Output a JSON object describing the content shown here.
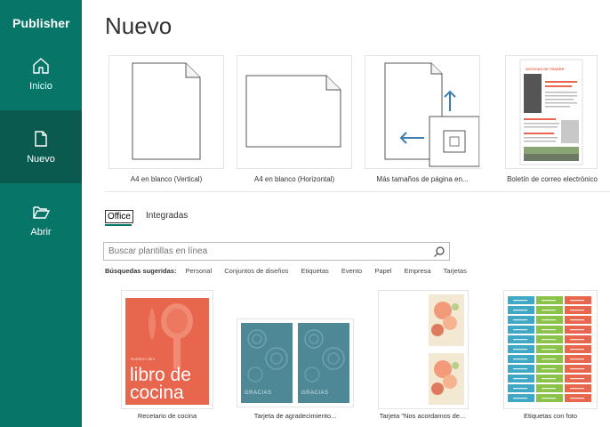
{
  "app": {
    "name": "Publisher"
  },
  "nav": [
    {
      "id": "inicio",
      "label": "Inicio",
      "icon": "home-icon"
    },
    {
      "id": "nuevo",
      "label": "Nuevo",
      "icon": "new-document-icon",
      "active": true
    },
    {
      "id": "abrir",
      "label": "Abrir",
      "icon": "open-folder-icon"
    }
  ],
  "page": {
    "title": "Nuevo"
  },
  "blank_templates": [
    {
      "label": "A4 en blanco (Vertical)"
    },
    {
      "label": "A4 en blanco (Horizontal)"
    },
    {
      "label": "Más tamaños de página en..."
    },
    {
      "label": "Boletín de correo electrónico",
      "heading": "NOTICIAS DE TRADER"
    }
  ],
  "tabs": [
    {
      "label": "Office",
      "active": true
    },
    {
      "label": "Integradas"
    }
  ],
  "search": {
    "placeholder": "Buscar plantillas en línea",
    "value": ""
  },
  "suggested": {
    "lead": "Búsquedas sugeridas:",
    "items": [
      "Personal",
      "Conjuntos de diseños",
      "Etiquetas",
      "Evento",
      "Papel",
      "Empresa",
      "Tarjetas"
    ]
  },
  "templates": [
    {
      "label": "Recetario de cocina",
      "cover_small": "Nombre Libro",
      "cover_title_1": "libro de",
      "cover_title_2": "cocina"
    },
    {
      "label": "Tarjeta de agradecimiento...",
      "card_text": "GRACIAS"
    },
    {
      "label": "Tarjeta \"Nos acordamos de..."
    },
    {
      "label": "Etiquetas con foto"
    }
  ],
  "colors": {
    "sidebar": "#077568",
    "sidebar_active": "#0a5a50",
    "accent": "#077568",
    "cookbook": "#e8664d",
    "card_teal": "#4e8796"
  }
}
